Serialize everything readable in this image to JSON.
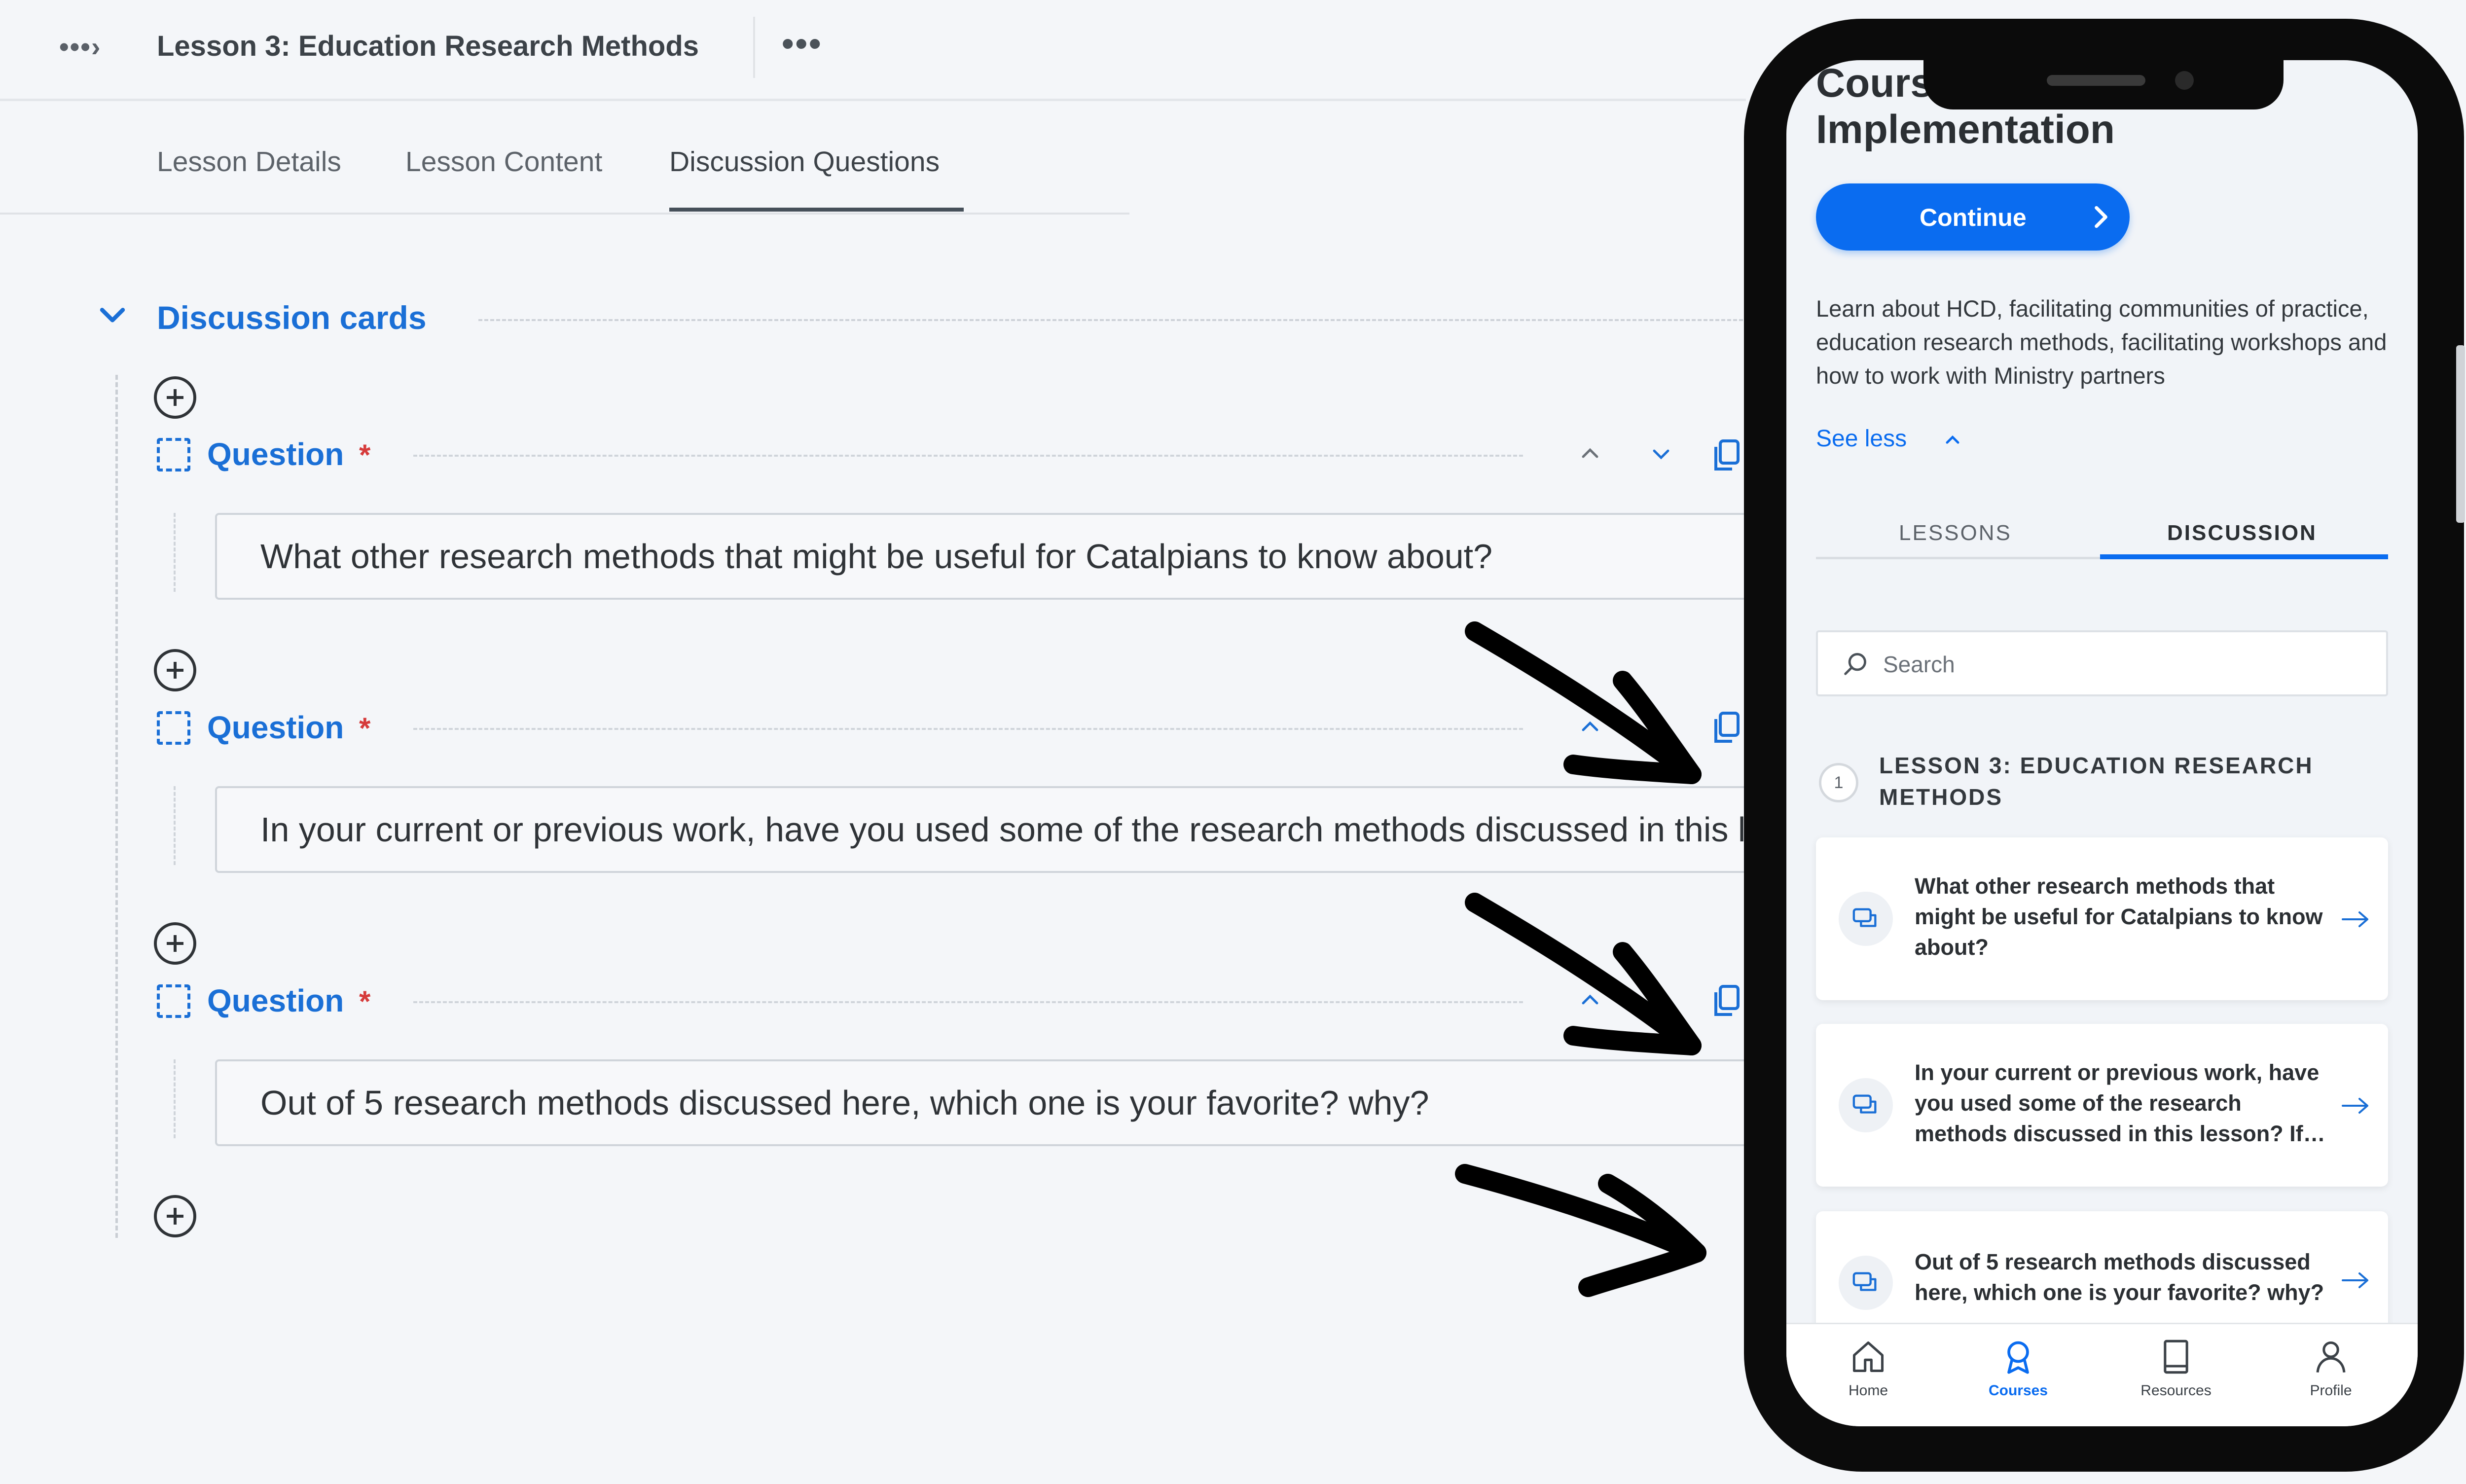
{
  "editor": {
    "breadcrumb_icon": "•••›",
    "lesson_title": "Lesson 3: Education Research Methods",
    "more_label": "•••",
    "tabs": [
      {
        "label": "Lesson Details"
      },
      {
        "label": "Lesson Content"
      },
      {
        "label": "Discussion Questions"
      }
    ],
    "active_tab": "Discussion Questions",
    "section_title": "Discussion cards",
    "question_label": "Question",
    "required_mark": "*",
    "questions": [
      {
        "value": "What other research methods that might be useful for Catalpians to know about?"
      },
      {
        "value": "In your current or previous work, have you used some of the research methods discussed in this lesson? If so, how did you use them?"
      },
      {
        "value": "Out of 5 research methods discussed here, which one is your favorite? why?"
      }
    ]
  },
  "phone": {
    "title": "Course: Program Implementation",
    "continue_label": "Continue",
    "description": "Learn about HCD, facilitating communities of practice, education research methods, facilitating workshops and how to work with Ministry partners",
    "see_less_label": "See less",
    "tabs": [
      {
        "label": "LESSONS"
      },
      {
        "label": "DISCUSSION"
      }
    ],
    "active_tab": "DISCUSSION",
    "search_placeholder": "Search",
    "lesson_number": "1",
    "lesson_heading": "LESSON 3: EDUCATION RESEARCH METHODS",
    "discussions": [
      {
        "text": "What other research methods that might be useful for Catalpians to know about?"
      },
      {
        "text": "In your current or previous work, have you used some of the research methods discussed in this lesson? If…"
      },
      {
        "text": "Out of 5 research methods discussed here, which one is your favorite? why?"
      }
    ],
    "nav": [
      {
        "label": "Home",
        "icon": "home-icon"
      },
      {
        "label": "Courses",
        "icon": "courses-icon"
      },
      {
        "label": "Resources",
        "icon": "resources-icon"
      },
      {
        "label": "Profile",
        "icon": "profile-icon"
      }
    ],
    "active_nav": "Courses"
  },
  "colors": {
    "accent_blue": "#1a6fd6",
    "phone_blue": "#0a6cf0",
    "required_red": "#d63b3b",
    "background": "#f4f6f9"
  }
}
